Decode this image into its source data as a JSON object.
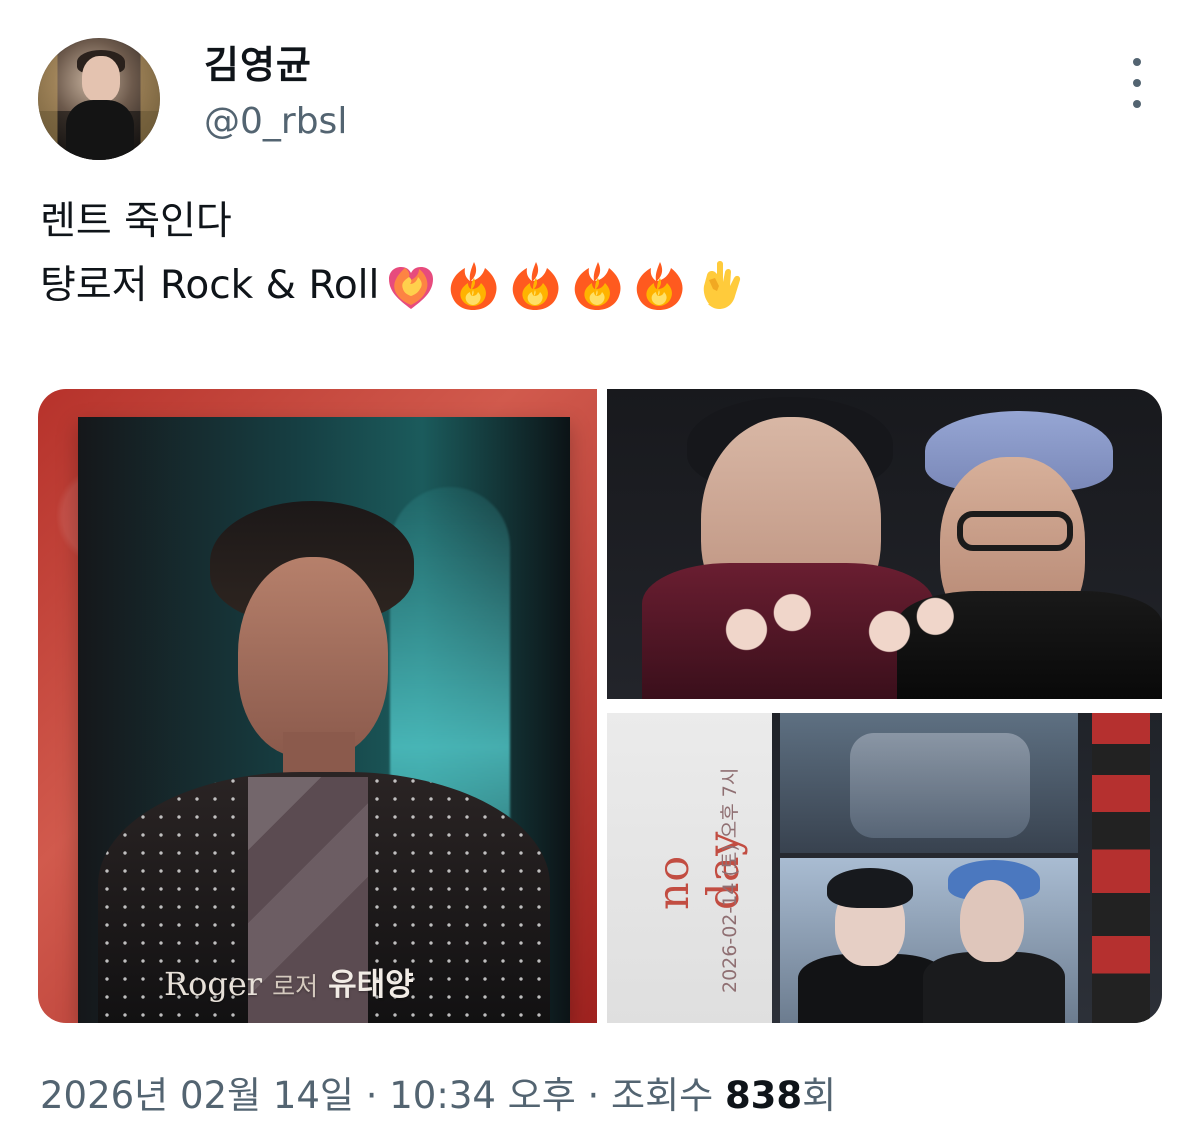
{
  "user": {
    "display_name": "김영균",
    "handle": "@0_rbsl"
  },
  "tweet": {
    "line1": "렌트 죽인다",
    "line2_text": "턍로저 Rock & Roll",
    "emoji": [
      "heart-on-fire-icon",
      "fire-icon",
      "fire-icon",
      "fire-icon",
      "fire-icon",
      "rock-on-hand-icon"
    ]
  },
  "media": {
    "poster_caption_en": "Roger",
    "poster_caption_kr": "로저",
    "poster_actor": "유태양",
    "ticket_no": "no day",
    "ticket_date": "2026-02-14 (토) 오후 7시"
  },
  "meta": {
    "date": "2026년 02월 14일",
    "separator_1": " · ",
    "time": "10:34 오후",
    "separator_2": " · ",
    "views_label": "조회수",
    "views_count": "838",
    "views_suffix": "회"
  },
  "colors": {
    "text_primary": "#0f1419",
    "text_secondary": "#536471"
  }
}
